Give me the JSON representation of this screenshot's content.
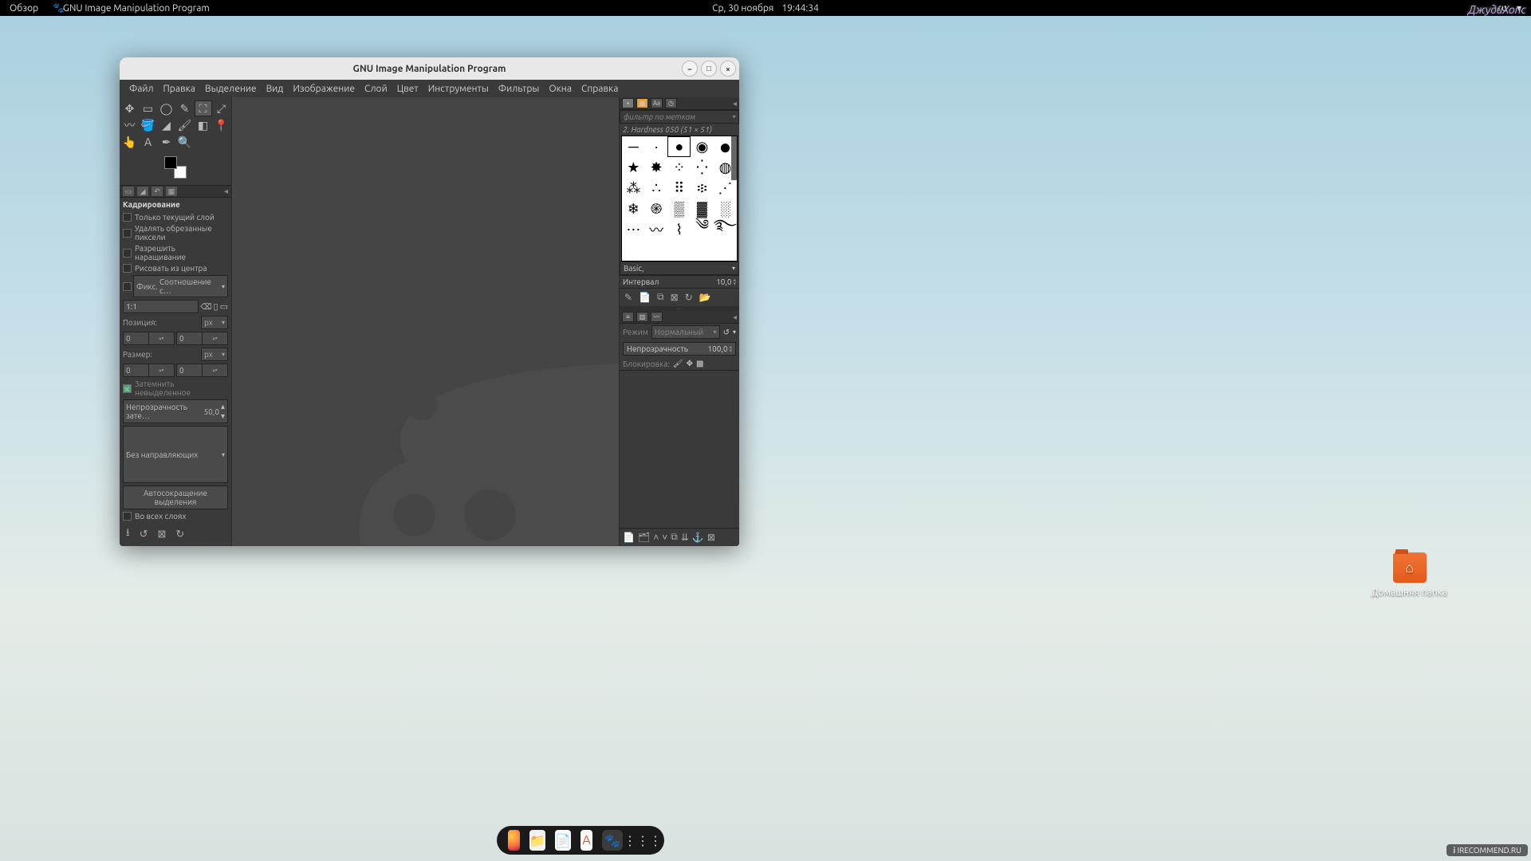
{
  "topbar": {
    "overview": "Обзор",
    "app": "GNU Image Manipulation Program",
    "date": "Ср, 30 ноября",
    "time": "19:44:34",
    "lang": "ru"
  },
  "watermark": "ДжудиХопс",
  "irecommend": "IRECOMMEND.RU",
  "desktop": {
    "home": "Домашняя папка"
  },
  "window": {
    "title": "GNU Image Manipulation Program",
    "menu": [
      "Файл",
      "Правка",
      "Выделение",
      "Вид",
      "Изображение",
      "Слой",
      "Цвет",
      "Инструменты",
      "Фильтры",
      "Окна",
      "Справка"
    ],
    "tool_options": {
      "title": "Кадрирование",
      "chk_current_layer": "Только текущий слой",
      "chk_delete_cropped": "Удалять обрезанные пиксели",
      "chk_allow_grow": "Разрешить наращивание",
      "chk_from_center": "Рисовать из центра",
      "fixed": "Фикс.",
      "fixed_mode": "Соотношение с…",
      "ratio": "1:1",
      "position": "Позиция:",
      "unit_px": "px",
      "pos_x": "0",
      "pos_y": "0",
      "size": "Размер:",
      "size_w": "0",
      "size_h": "0",
      "highlight": "Затемнить невыделенное",
      "highlight_opacity_label": "Непрозрачность зате…",
      "highlight_opacity": "50,0",
      "guides": "Без направляющих",
      "autoshrink": "Автосокращение выделения",
      "all_layers": "Во всех слоях"
    },
    "brushes": {
      "filter_placeholder": "фильтр по меткам",
      "current": "2. Hardness 050 (51 × 51)",
      "preset_set": "Basic,",
      "spacing_label": "Интервал",
      "spacing": "10,0"
    },
    "layers": {
      "mode_label": "Режим",
      "mode": "Нормальный",
      "opacity_label": "Непрозрачность",
      "opacity": "100,0",
      "lock_label": "Блокировка:"
    }
  }
}
